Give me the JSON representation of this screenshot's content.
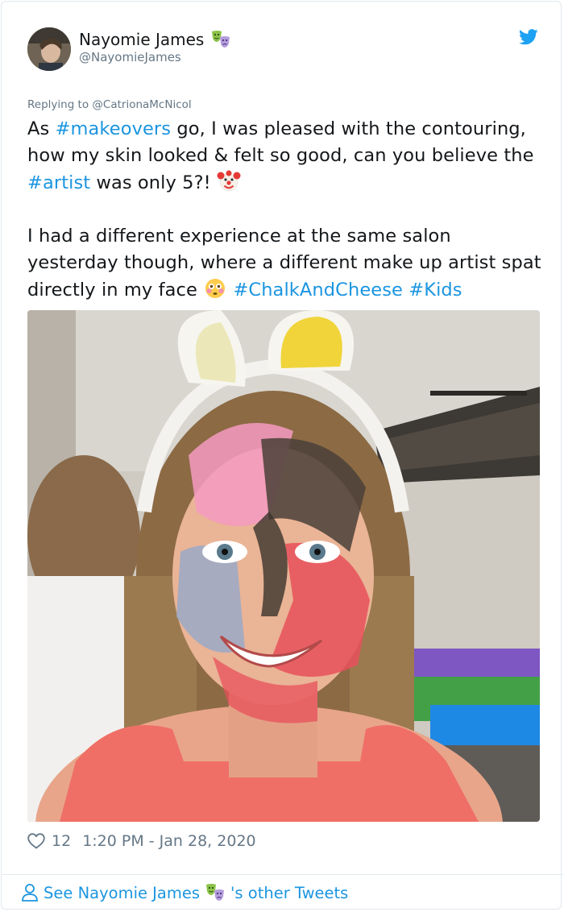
{
  "tweet": {
    "author_name": "Nayomie James",
    "author_handle": "@NayomieJames",
    "author_emoji": "performing-arts-emoji",
    "replying_to": "Replying to @CatrionaMcNicol",
    "text": {
      "p1": {
        "t1": "As ",
        "h1": "#makeovers",
        "t2": " go, I was pleased with the contouring, how my skin looked & felt so good, can you believe the ",
        "h2": "#artist",
        "t3": " was only 5?! ",
        "emoji": "clown-face-emoji"
      },
      "p2": {
        "t1": "I had a different experience at the same salon yesterday though, where a different make up artist spat directly in my face ",
        "emoji": "flushed-face-emoji",
        "t2": " ",
        "h1": "#ChalkAndCheese",
        "t3": " ",
        "h2": "#Kids"
      }
    },
    "image": "photo-woman-with-painted-face-bunny-ears",
    "likes": "12",
    "timestamp": "1:20 PM - Jan 28, 2020"
  },
  "footer": {
    "see_prefix": "See Nayomie James ",
    "see_suffix": "'s other Tweets"
  },
  "colors": {
    "link": "#1b95e0",
    "muted": "#657786",
    "text": "#14171a",
    "border": "#e1e8ed"
  }
}
